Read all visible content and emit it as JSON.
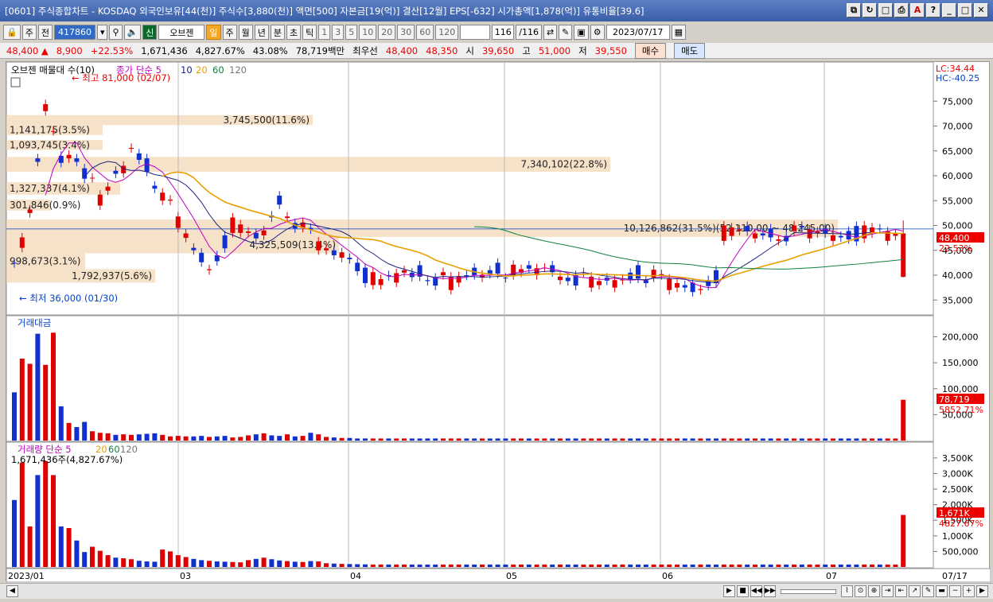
{
  "window": {
    "title": "[0601] 주식종합차트 - KOSDAQ 외국인보유[44(천)] 주식수[3,880(천)] 액면[500] 자본금[19(억)] 결산[12월] EPS[-632] 시가총액[1,878(억)] 유통비율[39.6]"
  },
  "toolbar": {
    "period_select": "주",
    "all_label": "전",
    "code": "417860",
    "market_badge": "신",
    "stock_name": "오브젠",
    "intervals": [
      "일",
      "주",
      "월",
      "년",
      "분",
      "초",
      "틱"
    ],
    "minute_options": [
      "1",
      "3",
      "5",
      "10",
      "20",
      "30",
      "60",
      "120"
    ],
    "count": "116",
    "count_total": "/116",
    "date": "2023/07/17"
  },
  "quote": {
    "price": "48,400",
    "change": "8,900",
    "change_pct": "+22.53%",
    "volume": "1,671,436",
    "volume_pct": "4,827.67%",
    "turnover": "43.08%",
    "amount": "78,719백만",
    "best_ask_label": "최우선",
    "best_ask": "48,400",
    "best_bid": "48,350",
    "open_label": "시",
    "open": "39,650",
    "high_label": "고",
    "high": "51,000",
    "low_label": "저",
    "low": "39,550",
    "buy_label": "매수",
    "sell_label": "매도"
  },
  "panels": {
    "price_legend": "오브젠 매물대 수(10)",
    "ma_legend": "종가 단순 5",
    "ma_periods": [
      "10",
      "20",
      "60",
      "120"
    ],
    "lc": "LC:34.44",
    "hc": "HC:-40.25",
    "max_label": "최고 81,000 (02/07)",
    "min_label": "최저 36,000 (01/30)",
    "current_price_tag": "48,400",
    "current_pct_tag": "22.53%",
    "amount_title": "거래대금",
    "amount_tag": "78,719",
    "amount_pct_tag": "5852.71%",
    "volume_title": "거래량 단순 5",
    "volume_ma_periods": [
      "20",
      "60",
      "120"
    ],
    "volume_info": "1,671,436주(4,827.67%)",
    "volume_tag": "1,671K",
    "volume_pct_tag": "4827.67%"
  },
  "price_ticks": [
    "75,000",
    "70,000",
    "65,000",
    "60,000",
    "55,000",
    "50,000",
    "45,000",
    "40,000",
    "35,000"
  ],
  "amount_ticks": [
    "200,000",
    "150,000",
    "100,000",
    "50,000"
  ],
  "volume_ticks": [
    "3,500K",
    "3,000K",
    "2,500K",
    "2,000K",
    "1,500K",
    "1,000K",
    "500,000"
  ],
  "x_labels": [
    "2023/01",
    "03",
    "04",
    "05",
    "06",
    "07",
    "07/17"
  ],
  "volume_profile": [
    {
      "label": "3,745,500(11.6%)"
    },
    {
      "label": "1,141,175(3.5%)"
    },
    {
      "label": "1,093,745(3.4%)"
    },
    {
      "label": "7,340,102(22.8%)"
    },
    {
      "label": "1,327,337(4.1%)"
    },
    {
      "label": "301,846(0.9%)"
    },
    {
      "label": "10,126,862(31.5%)(52,110.00 ~ 48,245.00)"
    },
    {
      "label": "4,325,509(13.4%)"
    },
    {
      "label": "998,673(3.1%)"
    },
    {
      "label": "1,792,937(5.6%)"
    }
  ],
  "colors": {
    "up": "#e00000",
    "down": "#1030d0",
    "ma5": "#c000c0",
    "ma10": "#1a237e",
    "ma20": "#e8a000",
    "ma60": "#108040",
    "profile": "#f5dcc0"
  }
}
